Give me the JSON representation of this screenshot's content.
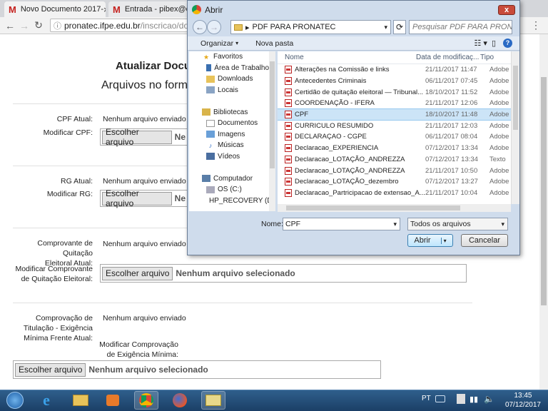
{
  "browser": {
    "tabs": [
      {
        "title": "Novo Documento 2017-",
        "favicon": "M"
      },
      {
        "title": "Entrada - pibex@car",
        "favicon": "M"
      }
    ],
    "url_host": "pronatec.ifpe.edu.br",
    "url_path": "/inscricao/docum"
  },
  "page": {
    "title": "Atualizar Docu",
    "subtitle": "Arquivos no forma",
    "sections": [
      {
        "current_label": "CPF Atual:",
        "current_value": "Nenhum arquivo enviado",
        "modify_label": "Modificar CPF:",
        "file_button": "Escolher arquivo",
        "file_status": "Ne"
      },
      {
        "current_label": "RG Atual:",
        "current_value": "Nenhum arquivo enviado",
        "modify_label": "Modificar RG:",
        "file_button": "Escolher arquivo",
        "file_status": "Ne"
      },
      {
        "current_label_1": "Comprovante de Quitação",
        "current_label_2": "Eleitoral Atual:",
        "current_value": "Nenhum arquivo enviado",
        "modify_label_1": "Modificar Comprovante",
        "modify_label_2": "de Quitação Eleitoral:",
        "file_button": "Escolher arquivo",
        "file_status": "Nenhum arquivo selecionado"
      },
      {
        "current_label_1": "Comprovação de",
        "current_label_2": "Titulação - Exigência",
        "current_label_3": "Mínima Frente Atual:",
        "current_value": "Nenhum arquivo enviado",
        "modify_label_1": "Modificar Comprovação",
        "modify_label_2": "de Exigência Mínima:",
        "file_button": "Escolher arquivo",
        "file_status": "Nenhum arquivo selecionado"
      }
    ]
  },
  "dialog": {
    "title": "Abrir",
    "close": "x",
    "path": "PDF PARA PRONATEC",
    "search_placeholder": "Pesquisar PDF PARA PRONAT...",
    "organize": "Organizar",
    "new_folder": "Nova pasta",
    "nav": [
      {
        "label": "Favoritos",
        "group": true
      },
      {
        "label": "Área de Trabalho"
      },
      {
        "label": "Downloads"
      },
      {
        "label": "Locais"
      },
      {
        "label": "",
        "spacer": true
      },
      {
        "label": "Bibliotecas",
        "group": true
      },
      {
        "label": "Documentos"
      },
      {
        "label": "Imagens"
      },
      {
        "label": "Músicas"
      },
      {
        "label": "Vídeos"
      },
      {
        "label": "",
        "spacer": true
      },
      {
        "label": "Computador",
        "group": true
      },
      {
        "label": "OS (C:)"
      },
      {
        "label": "HP_RECOVERY (D"
      }
    ],
    "columns": {
      "name": "Nome",
      "date": "Data de modificaç...",
      "type": "Tipo"
    },
    "files": [
      {
        "name": "Alterações na Comissão e links",
        "date": "21/11/2017 11:47",
        "type": "Adobe"
      },
      {
        "name": "Antecedentes Criminais",
        "date": "06/11/2017 07:45",
        "type": "Adobe"
      },
      {
        "name": "Certidão de quitação eleitoral — Tribunal...",
        "date": "18/10/2017 11:52",
        "type": "Adobe"
      },
      {
        "name": "COORDENAÇÃO - IFERA",
        "date": "21/11/2017 12:06",
        "type": "Adobe"
      },
      {
        "name": "CPF",
        "date": "18/10/2017 11:48",
        "type": "Adobe",
        "selected": true
      },
      {
        "name": "CURRICULO RESUMIDO",
        "date": "21/11/2017 12:03",
        "type": "Adobe"
      },
      {
        "name": "DECLARAÇAO - CGPE",
        "date": "06/11/2017 08:04",
        "type": "Adobe"
      },
      {
        "name": "Declaracao_EXPERIENCIA",
        "date": "07/12/2017 13:34",
        "type": "Adobe"
      },
      {
        "name": "Declaracao_LOTAÇÃO_ANDREZZA",
        "date": "07/12/2017 13:34",
        "type": "Texto"
      },
      {
        "name": "Declaracao_LOTAÇÃO_ANDREZZA",
        "date": "21/11/2017 10:50",
        "type": "Adobe"
      },
      {
        "name": "Declaracao_LOTAÇÃO_dezembro",
        "date": "07/12/2017 13:27",
        "type": "Adobe"
      },
      {
        "name": "Declaracao_Partricipacao de extensao_A...",
        "date": "21/11/2017 10:04",
        "type": "Adobe"
      }
    ],
    "name_label": "Nome:",
    "name_value": "CPF",
    "type_filter": "Todos os arquivos",
    "open_button": "Abrir",
    "cancel_button": "Cancelar"
  },
  "taskbar": {
    "lang": "PT",
    "time": "13:45",
    "date": "07/12/2017"
  },
  "colors": {
    "accent": "#3b6ea5",
    "dialog_bg": "#cfdcec",
    "selection": "#cce4f7"
  }
}
